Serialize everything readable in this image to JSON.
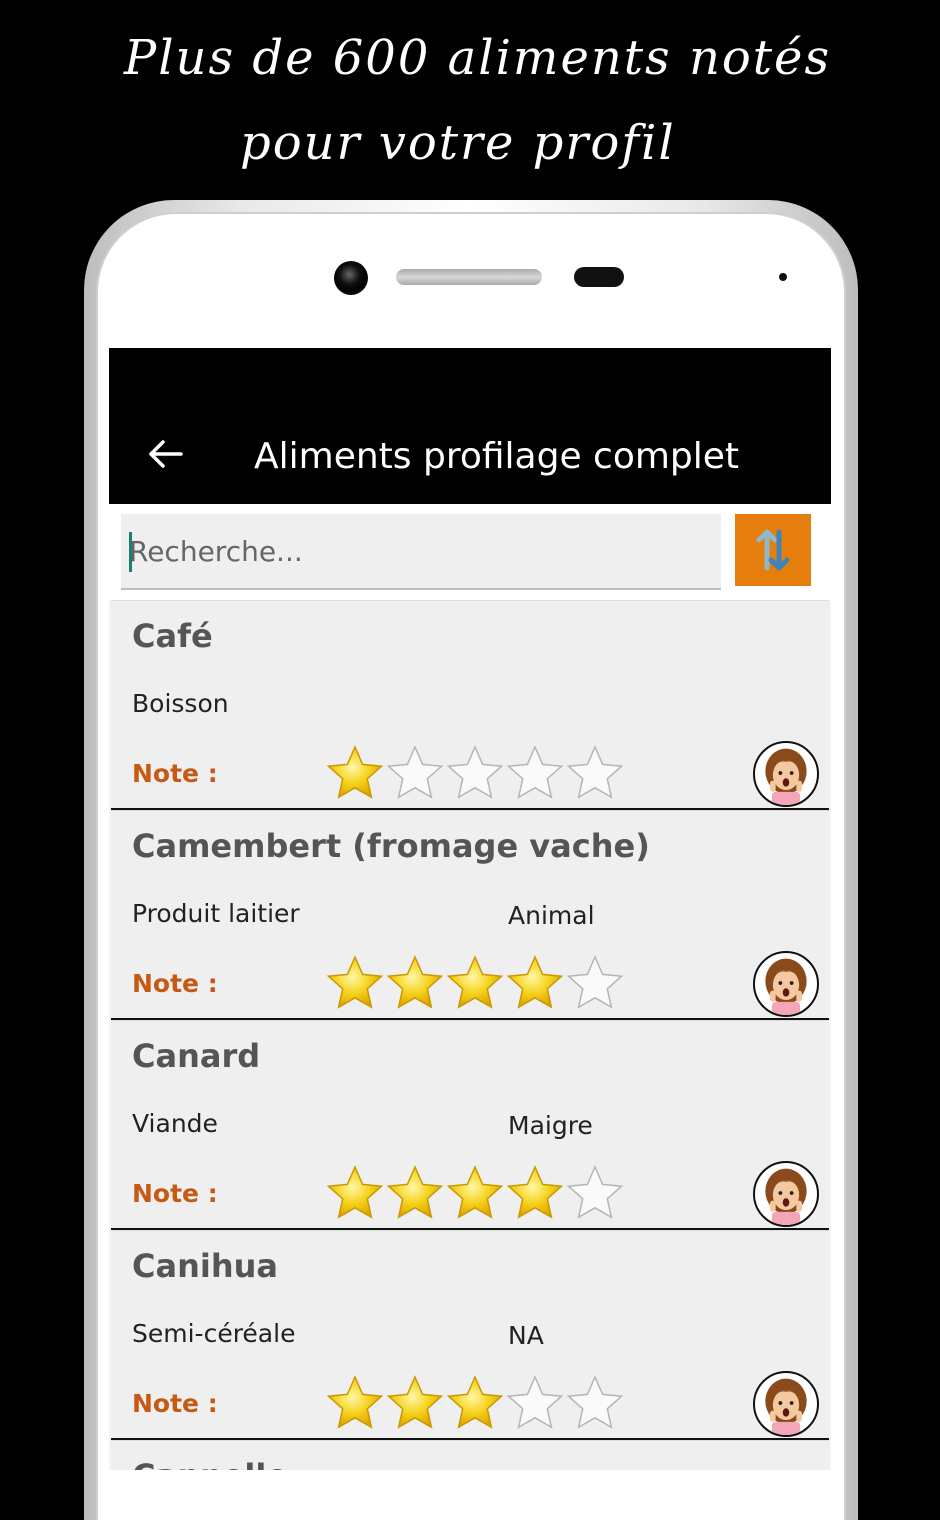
{
  "promo": {
    "line1": "Plus de 600 aliments notés",
    "line2": "pour votre profil"
  },
  "app_bar": {
    "title": "Aliments profilage complet",
    "back_icon": "arrow-left-icon"
  },
  "search": {
    "placeholder": "Recherche...",
    "value": ""
  },
  "sort_button": {
    "icon": "sort-arrows-icon",
    "color": "#e67e0e"
  },
  "colors": {
    "note_label": "#c75a13",
    "star_fill": "#f5d21c",
    "app_bar": "#000000"
  },
  "note_label": "Note :",
  "items": [
    {
      "name": "Café",
      "category": "Boisson",
      "subcategory": "",
      "rating": 1,
      "max_rating": 5
    },
    {
      "name": "Camembert (fromage vache)",
      "category": "Produit laitier",
      "subcategory": "Animal",
      "rating": 4,
      "max_rating": 5
    },
    {
      "name": "Canard",
      "category": "Viande",
      "subcategory": "Maigre",
      "rating": 4,
      "max_rating": 5
    },
    {
      "name": "Canihua",
      "category": "Semi-céréale",
      "subcategory": "NA",
      "rating": 3,
      "max_rating": 5
    }
  ],
  "partial_item": {
    "name": "Cannelle"
  }
}
